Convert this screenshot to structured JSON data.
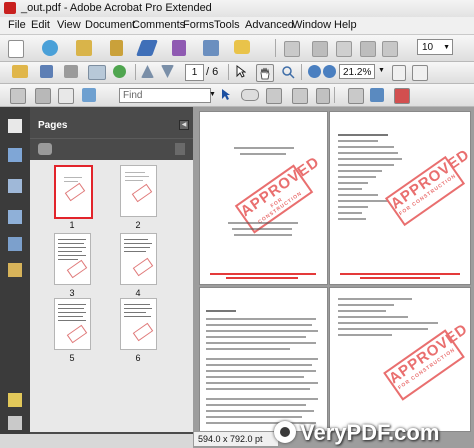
{
  "window": {
    "title": "_out.pdf - Adobe Acrobat Pro Extended"
  },
  "menu": [
    "File",
    "Edit",
    "View",
    "Document",
    "Comments",
    "Forms",
    "Tools",
    "Advanced",
    "Window",
    "Help"
  ],
  "toolbar": {
    "page_current": "1",
    "page_total": "/ 6",
    "zoom": "21.2%",
    "font_size": "10",
    "find_placeholder": "Find"
  },
  "panel": {
    "title": "Pages",
    "thumbnails": [
      {
        "label": "1",
        "selected": true
      },
      {
        "label": "2",
        "selected": false
      },
      {
        "label": "3",
        "selected": false
      },
      {
        "label": "4",
        "selected": false
      },
      {
        "label": "5",
        "selected": false
      },
      {
        "label": "6",
        "selected": false
      }
    ]
  },
  "document": {
    "stamp_text": "APPROVED",
    "stamp_subtext": "FOR CONSTRUCTION"
  },
  "status": {
    "page_size": "594.0 x 792.0 pt"
  },
  "watermark": {
    "text": "VeryPDF.com"
  },
  "colors": {
    "stamp": "#e96f6f",
    "selection": "#e2242b",
    "panel": "#4a4a4a"
  }
}
